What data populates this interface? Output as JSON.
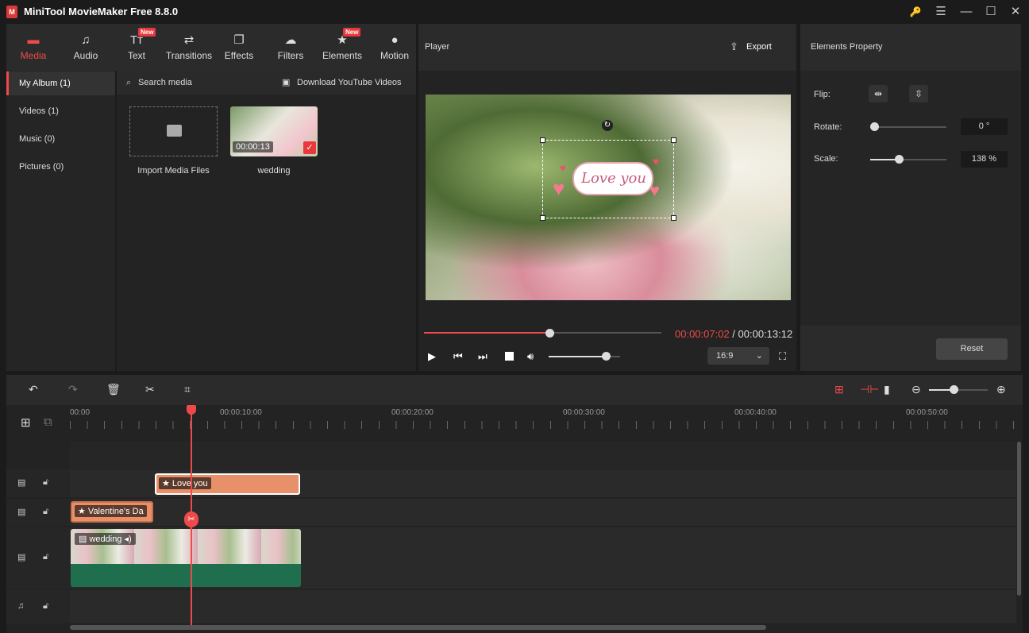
{
  "app": {
    "title": "MiniTool MovieMaker Free 8.8.0",
    "logo_letter": "M"
  },
  "window_controls": {
    "key": "🔑",
    "menu": "☰",
    "minimize": "—",
    "maximize": "☐",
    "close": "✕"
  },
  "toolbar": {
    "items": [
      {
        "label": "Media",
        "icon": "📁",
        "new": false
      },
      {
        "label": "Audio",
        "icon": "♫",
        "new": false
      },
      {
        "label": "Text",
        "icon": "Tт",
        "new": true
      },
      {
        "label": "Transitions",
        "icon": "⇄",
        "new": false
      },
      {
        "label": "Effects",
        "icon": "❐",
        "new": false
      },
      {
        "label": "Filters",
        "icon": "☁",
        "new": false
      },
      {
        "label": "Elements",
        "icon": "★",
        "new": true
      },
      {
        "label": "Motion",
        "icon": "●",
        "new": false
      }
    ],
    "new_badge": "New"
  },
  "sidebar": {
    "items": [
      {
        "label": "My Album (1)"
      },
      {
        "label": "Videos (1)"
      },
      {
        "label": "Music (0)"
      },
      {
        "label": "Pictures (0)"
      }
    ]
  },
  "media": {
    "search_placeholder": "Search media",
    "download_label": "Download YouTube Videos",
    "import_label": "Import Media Files",
    "clip_name": "wedding",
    "clip_duration": "00:00:13"
  },
  "player": {
    "header": "Player",
    "export_label": "Export",
    "overlay_text": "Love you",
    "current_time": "00:00:07:02",
    "separator": " / ",
    "total_time": "00:00:13:12",
    "aspect": "16:9",
    "progress": 0.53,
    "volume": 0.8
  },
  "properties": {
    "header": "Elements Property",
    "flip_label": "Flip:",
    "rotate_label": "Rotate:",
    "rotate_value": "0 °",
    "scale_label": "Scale:",
    "scale_value": "138 %",
    "reset_label": "Reset"
  },
  "timeline": {
    "ticks": [
      "00:00",
      "00:00:10:00",
      "00:00:20:00",
      "00:00:30:00",
      "00:00:40:00",
      "00:00:50:00"
    ],
    "clips": {
      "element": "Love you",
      "text": "Valentine's Da",
      "video": "wedding"
    }
  },
  "colors": {
    "accent": "#ef4a4a",
    "clip_orange": "#e8906a",
    "audio_green": "#1f6e4d"
  }
}
